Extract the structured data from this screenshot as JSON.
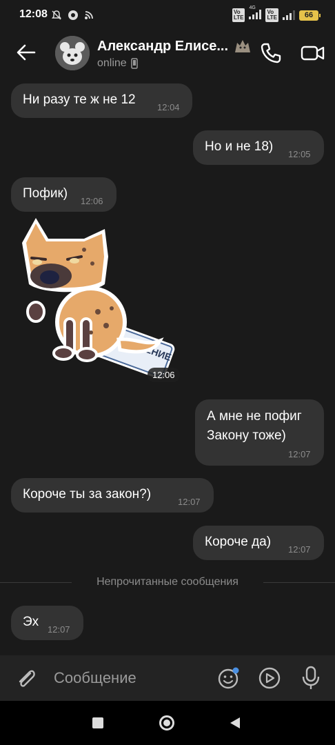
{
  "status_bar": {
    "time": "12:08",
    "network_4g": "4G",
    "battery": "66"
  },
  "header": {
    "contact_name": "Александр Елисе...",
    "status": "online"
  },
  "messages": [
    {
      "side": "in",
      "text": "Ни разу те ж не 12",
      "time": "12:04"
    },
    {
      "side": "out",
      "text": "Но и не 18)",
      "time": "12:05"
    },
    {
      "side": "in",
      "text": "Пофик)",
      "time": "12:06"
    },
    {
      "side": "in",
      "type": "sticker",
      "sticker_text": "ЧУЖОЕ МНЕНИЕ",
      "time": "12:06"
    },
    {
      "side": "out",
      "text_line1": "А мне не пофиг",
      "text_line2": "Закону тоже)",
      "time": "12:07"
    },
    {
      "side": "in",
      "text": "Короче ты за закон?)",
      "time": "12:07"
    },
    {
      "side": "out",
      "text": "Короче да)",
      "time": "12:07"
    },
    {
      "side": "in",
      "text": "Эх",
      "time": "12:07"
    }
  ],
  "unread_divider": "Непрочитанные сообщения",
  "composer": {
    "placeholder": "Сообщение"
  },
  "icons": {
    "back": "arrow-left-icon",
    "phone": "phone-icon",
    "video": "video-camera-icon",
    "attach": "paperclip-icon",
    "emoji": "smiley-icon",
    "play": "play-circle-icon",
    "mic": "microphone-icon"
  },
  "colors": {
    "background": "#1a1a1a",
    "bubble": "#333333",
    "time": "#8c8c8c",
    "battery": "#e5c24a",
    "unread_dot": "#4a90e2"
  }
}
